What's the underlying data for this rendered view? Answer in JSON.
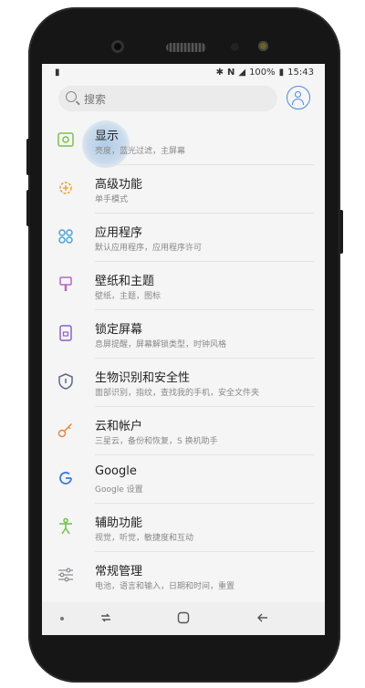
{
  "status": {
    "battery": "100%",
    "time": "15:43"
  },
  "search": {
    "placeholder": "搜索"
  },
  "settings": [
    {
      "title": "显示",
      "sub": "亮度，蓝光过滤，主屏幕",
      "icon": "display-icon",
      "color": "#7fbf4a"
    },
    {
      "title": "高级功能",
      "sub": "单手模式",
      "icon": "gear-plus-icon",
      "color": "#e9a43a"
    },
    {
      "title": "应用程序",
      "sub": "默认应用程序，应用程序许可",
      "icon": "apps-icon",
      "color": "#4aa3d6"
    },
    {
      "title": "壁纸和主题",
      "sub": "壁纸，主题，图标",
      "icon": "brush-icon",
      "color": "#b46bc2"
    },
    {
      "title": "锁定屏幕",
      "sub": "息屏提醒，屏幕解锁类型，时钟风格",
      "icon": "lock-icon",
      "color": "#8a63c3"
    },
    {
      "title": "生物识别和安全性",
      "sub": "面部识别，指纹，查找我的手机，安全文件夹",
      "icon": "shield-icon",
      "color": "#5b6a89"
    },
    {
      "title": "云和帐户",
      "sub": "三星云，备份和恢复，S 换机助手",
      "icon": "key-icon",
      "color": "#e58a3c"
    },
    {
      "title": "Google",
      "sub": "Google 设置",
      "icon": "google-icon",
      "color": "#3b7ae0"
    },
    {
      "title": "辅助功能",
      "sub": "视觉，听觉，敏捷度和互动",
      "icon": "accessibility-icon",
      "color": "#6ec04a"
    },
    {
      "title": "常规管理",
      "sub": "电池，语言和输入，日期和时间，重置",
      "icon": "sliders-icon",
      "color": "#8a8f9a"
    }
  ]
}
